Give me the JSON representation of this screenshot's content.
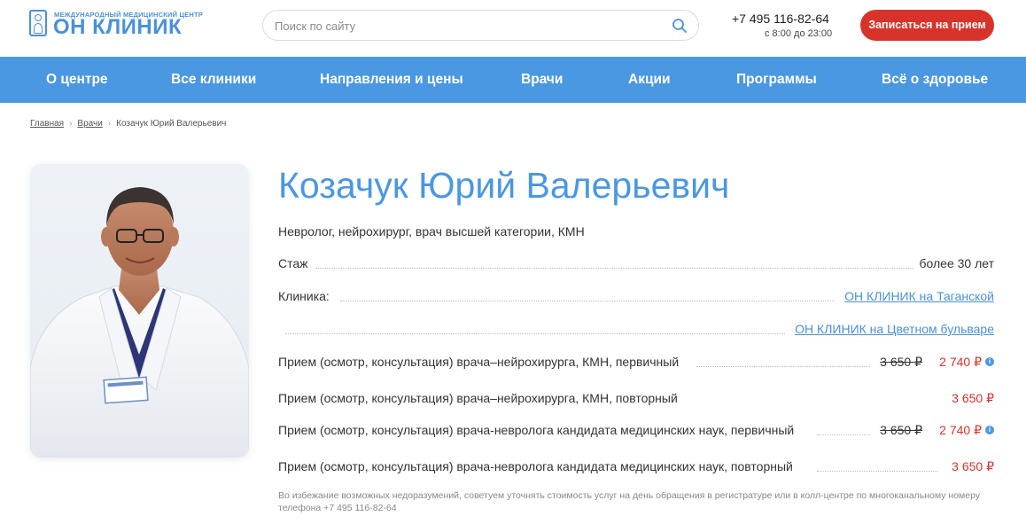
{
  "header": {
    "logo_sub": "МЕЖДУНАРОДНЫЙ МЕДИЦИНСКИЙ ЦЕНТР",
    "logo_main": "ОН КЛИНИК",
    "search_placeholder": "Поиск по сайту",
    "phone": "+7 495 116-82-64",
    "hours": "с 8:00 до 23:00",
    "cta_label": "Записаться на прием"
  },
  "nav": {
    "items": [
      "О центре",
      "Все клиники",
      "Направления и цены",
      "Врачи",
      "Акции",
      "Программы",
      "Всё о здоровье"
    ]
  },
  "breadcrumb": {
    "home": "Главная",
    "doctors": "Врачи",
    "current": "Козачук Юрий Валерьевич"
  },
  "doctor": {
    "name": "Козачук Юрий Валерьевич",
    "specialty": "Невролог, нейрохирург, врач высшей категории, КМН",
    "experience_label": "Стаж",
    "experience_value": "более 30 лет",
    "clinic_label": "Клиника:",
    "clinics": [
      "ОН КЛИНИК на Таганской",
      "ОН КЛИНИК на Цветном бульваре"
    ]
  },
  "services": [
    {
      "name": "Прием (осмотр, консультация) врача–нейрохирурга, КМН, первичный",
      "old_price": "3 650 ₽",
      "price": "2 740 ₽",
      "info": true
    },
    {
      "name": "Прием (осмотр, консультация) врача–нейрохирурга, КМН, повторный",
      "old_price": "",
      "price": "3 650 ₽",
      "info": false
    },
    {
      "name": "Прием (осмотр, консультация) врача-невролога кандидата медицинских наук, первичный",
      "old_price": "3 650 ₽",
      "price": "2 740 ₽",
      "info": true
    },
    {
      "name": "Прием (осмотр, консультация) врача-невролога кандидата медицинских наук, повторный",
      "old_price": "",
      "price": "3 650 ₽",
      "info": false
    }
  ],
  "note": "Во избежание возможных недоразумений, советуем уточнять стоимость услуг на день обращения в регистратуре или в колл-центре по многоканальному номеру телефона +7 495 116-82-64",
  "colors": {
    "accent": "#4a97e2",
    "cta": "#d8332b",
    "price": "#d8332b"
  }
}
